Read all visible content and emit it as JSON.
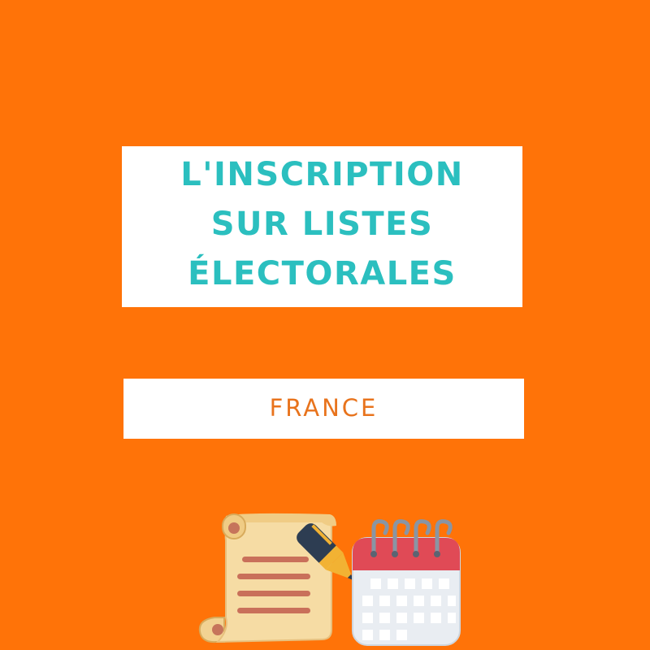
{
  "background_color": "#ff7308",
  "title": {
    "lines": [
      "L'INSCRIPTION",
      "SUR LISTES",
      "ÉLECTORALES"
    ],
    "color": "#2bbfbf"
  },
  "subtitle": {
    "text": "FRANCE",
    "color": "#e8731c"
  },
  "icons": [
    "scroll-with-pen-icon",
    "calendar-icon"
  ]
}
